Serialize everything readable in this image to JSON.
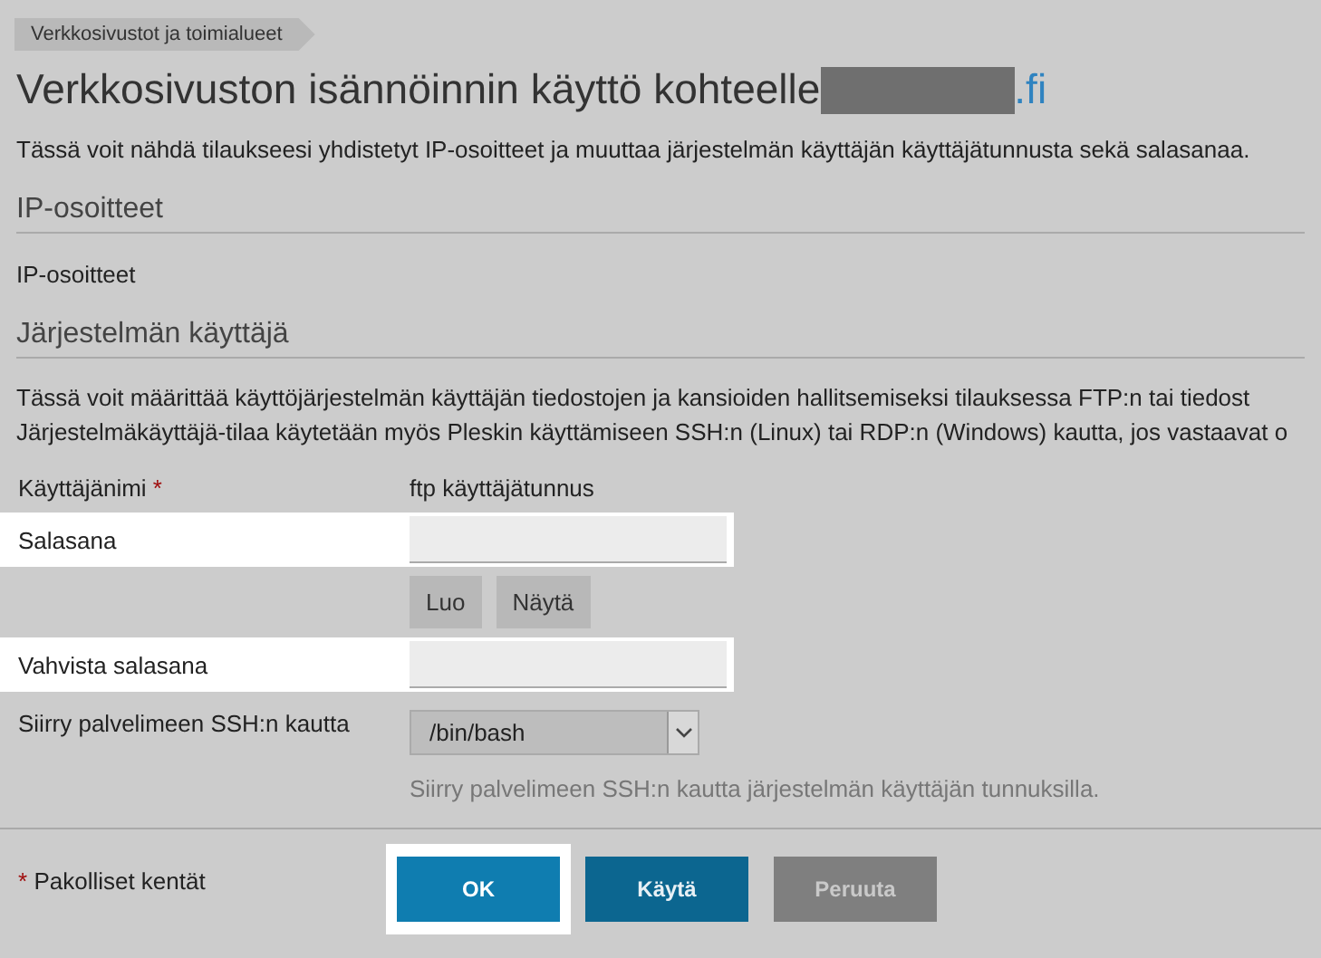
{
  "breadcrumb": "Verkkosivustot ja toimialueet",
  "title": {
    "text": "Verkkosivuston isännöinnin käyttö kohteelle",
    "redacted": true,
    "suffix": ".fi"
  },
  "intro": "Tässä voit nähdä tilaukseesi yhdistetyt IP-osoitteet ja muuttaa järjestelmän käyttäjän käyttäjätunnusta sekä salasanaa.",
  "ip_section": {
    "heading": "IP-osoitteet",
    "label": "IP-osoitteet"
  },
  "user_section": {
    "heading": "Järjestelmän käyttäjä",
    "paragraph": [
      "Tässä voit määrittää käyttöjärjestelmän käyttäjän tiedostojen ja kansioiden hallitsemiseksi tilauksessa FTP:n tai tiedost",
      "Järjestelmäkäyttäjä-tilaa käytetään myös Pleskin käyttämiseen SSH:n (Linux) tai RDP:n (Windows) kautta, jos vastaavat o"
    ]
  },
  "form": {
    "rows": [
      {
        "kind": "text",
        "label": "Käyttäjänimi",
        "required_mark": "*",
        "value": "ftp käyttäjätunnus",
        "highlighted": false
      },
      {
        "kind": "password",
        "label": "Salasana",
        "highlighted": true,
        "buttons": [
          "Luo",
          "Näytä"
        ]
      },
      {
        "kind": "password",
        "label": "Vahvista salasana",
        "highlighted": true
      },
      {
        "kind": "select",
        "label": "Siirry palvelimeen SSH:n kautta",
        "value": "/bin/bash",
        "hint": "Siirry palvelimeen SSH:n kautta järjestelmän käyttäjän tunnuksilla.",
        "highlighted": false
      }
    ]
  },
  "required_note": {
    "mark": "*",
    "text": "Pakolliset kentät"
  },
  "actions": [
    {
      "label": "OK",
      "kind": "primary",
      "highlighted": true
    },
    {
      "label": "Käytä",
      "kind": "secondary",
      "highlighted": false
    },
    {
      "label": "Peruuta",
      "kind": "cancel",
      "highlighted": false
    }
  ]
}
